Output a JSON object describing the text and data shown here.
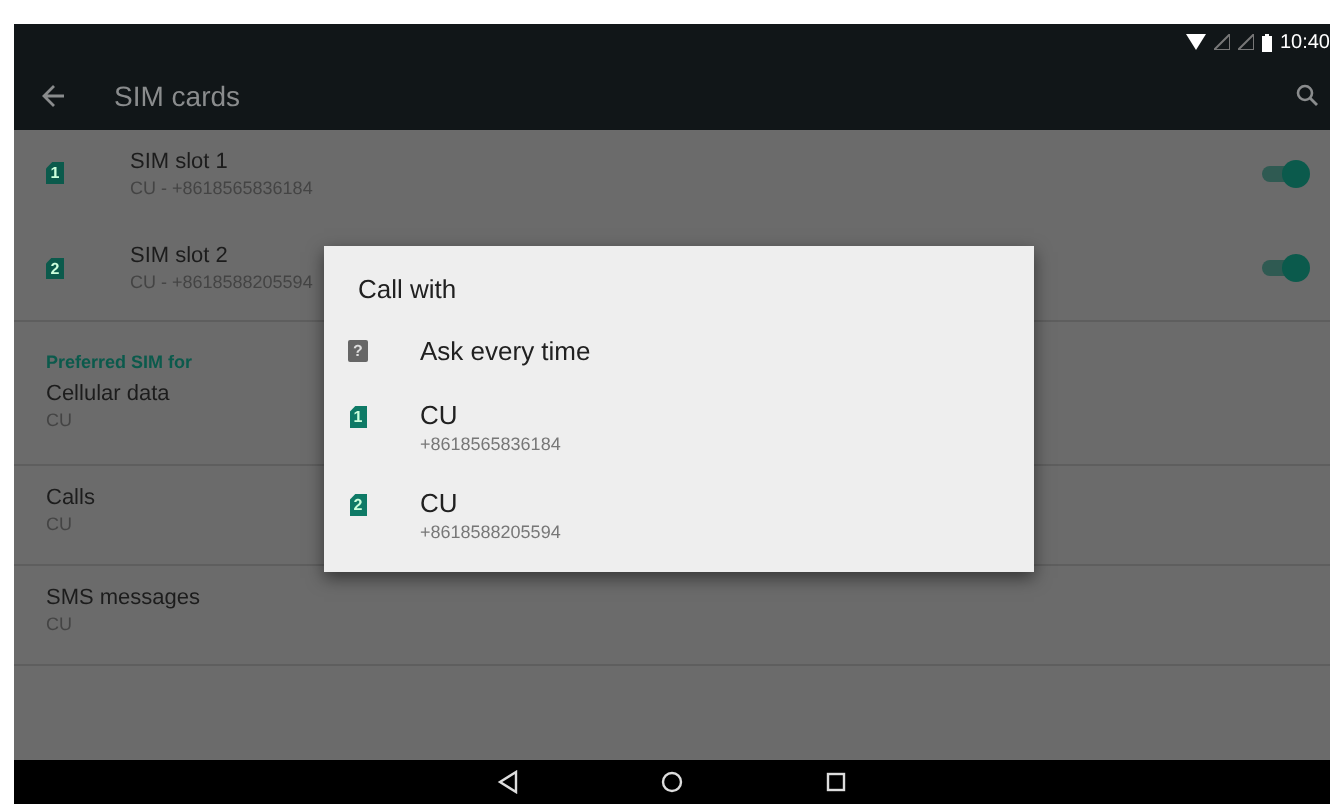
{
  "status_bar": {
    "time": "10:40"
  },
  "app_bar": {
    "title": "SIM cards"
  },
  "sim_slots": [
    {
      "title": "SIM slot 1",
      "summary": "CU - +8618565836184",
      "badge": "1",
      "on": true
    },
    {
      "title": "SIM slot 2",
      "summary": "CU - +8618588205594",
      "badge": "2",
      "on": true
    }
  ],
  "preferred": {
    "header": "Preferred SIM for",
    "items": [
      {
        "title": "Cellular data",
        "summary": "CU"
      },
      {
        "title": "Calls",
        "summary": "CU"
      },
      {
        "title": "SMS messages",
        "summary": "CU"
      }
    ]
  },
  "dialog": {
    "title": "Call with",
    "options": [
      {
        "kind": "ask",
        "label": "Ask every time",
        "glyph": "?"
      },
      {
        "kind": "sim",
        "label": "CU",
        "number": "+8618565836184",
        "badge": "1"
      },
      {
        "kind": "sim",
        "label": "CU",
        "number": "+8618588205594",
        "badge": "2"
      }
    ]
  }
}
